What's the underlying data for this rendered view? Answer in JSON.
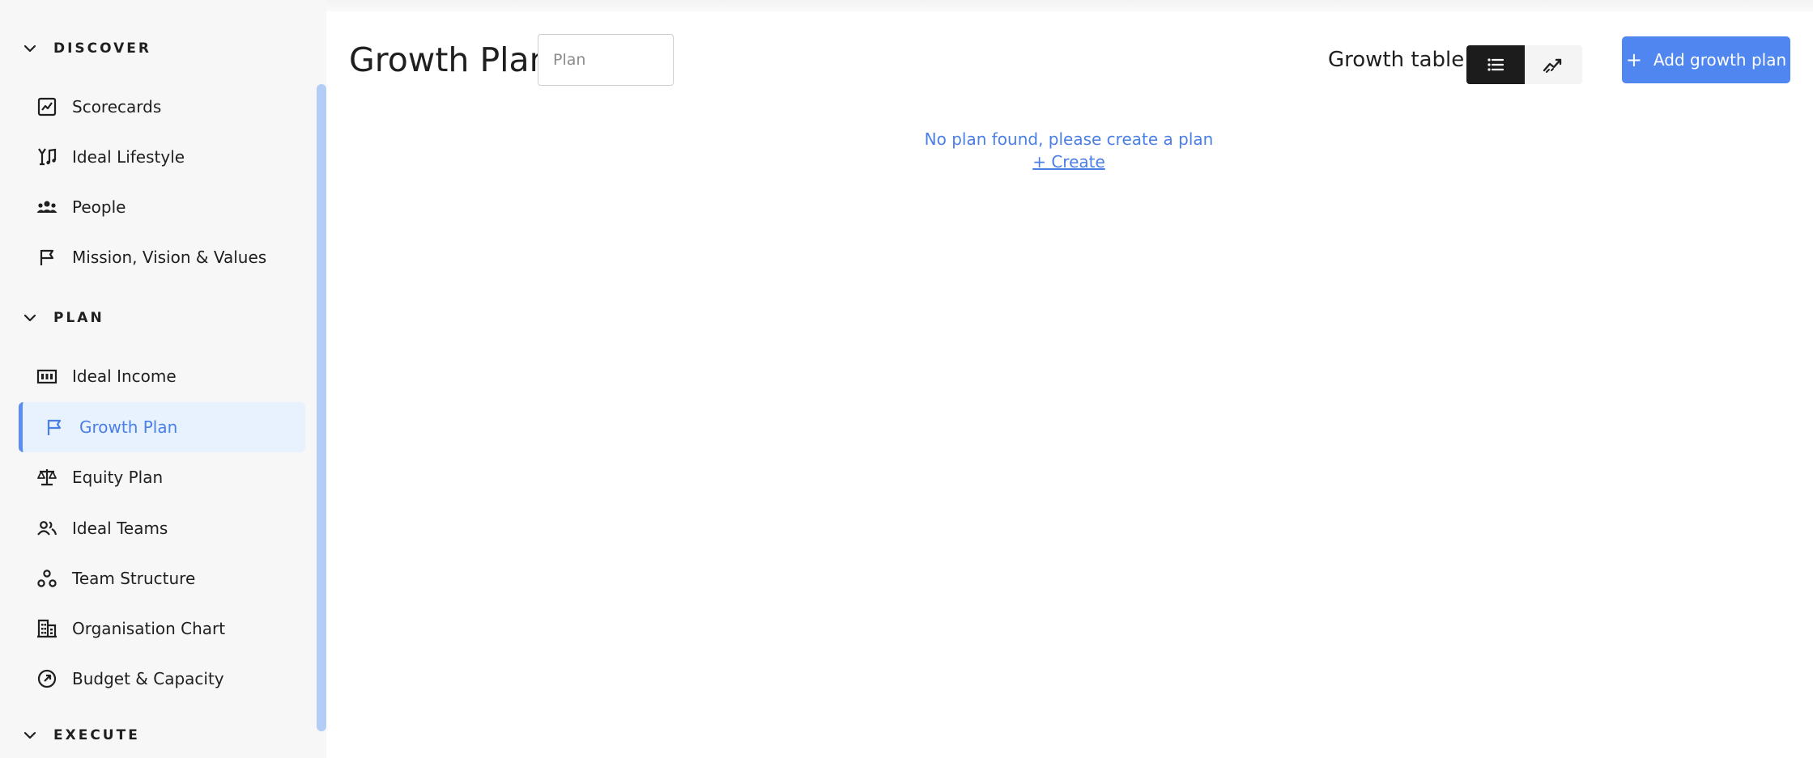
{
  "sidebar": {
    "sections": [
      {
        "label": "DISCOVER"
      },
      {
        "label": "PLAN"
      },
      {
        "label": "EXECUTE"
      }
    ],
    "discover_items": [
      {
        "label": "Scorecards",
        "icon": "chart-icon"
      },
      {
        "label": "Ideal Lifestyle",
        "icon": "lifestyle-icon"
      },
      {
        "label": "People",
        "icon": "people-icon"
      },
      {
        "label": "Mission, Vision & Values",
        "icon": "flag-icon"
      }
    ],
    "plan_items": [
      {
        "label": "Ideal Income",
        "icon": "income-icon"
      },
      {
        "label": "Growth Plan",
        "icon": "flag-icon",
        "active": true
      },
      {
        "label": "Equity Plan",
        "icon": "scale-icon"
      },
      {
        "label": "Ideal Teams",
        "icon": "teams-icon"
      },
      {
        "label": "Team Structure",
        "icon": "structure-icon"
      },
      {
        "label": "Organisation Chart",
        "icon": "building-icon"
      },
      {
        "label": "Budget & Capacity",
        "icon": "gauge-icon"
      }
    ]
  },
  "header": {
    "title": "Growth Plan",
    "plan_input": {
      "placeholder": "Plan",
      "value": ""
    },
    "view_label": "Growth table",
    "view_toggle": {
      "options": [
        "list-icon",
        "trend-icon"
      ],
      "selected": "list-icon"
    },
    "add_button_label": "Add growth plan"
  },
  "main": {
    "empty_message": "No plan found, please create a plan",
    "create_link": "+ Create"
  },
  "colors": {
    "accent": "#4f86f0",
    "active_bg": "#e8f1fe",
    "toggle_selected": "#1c1c1c",
    "sidebar_bg": "#f7f7f7"
  }
}
